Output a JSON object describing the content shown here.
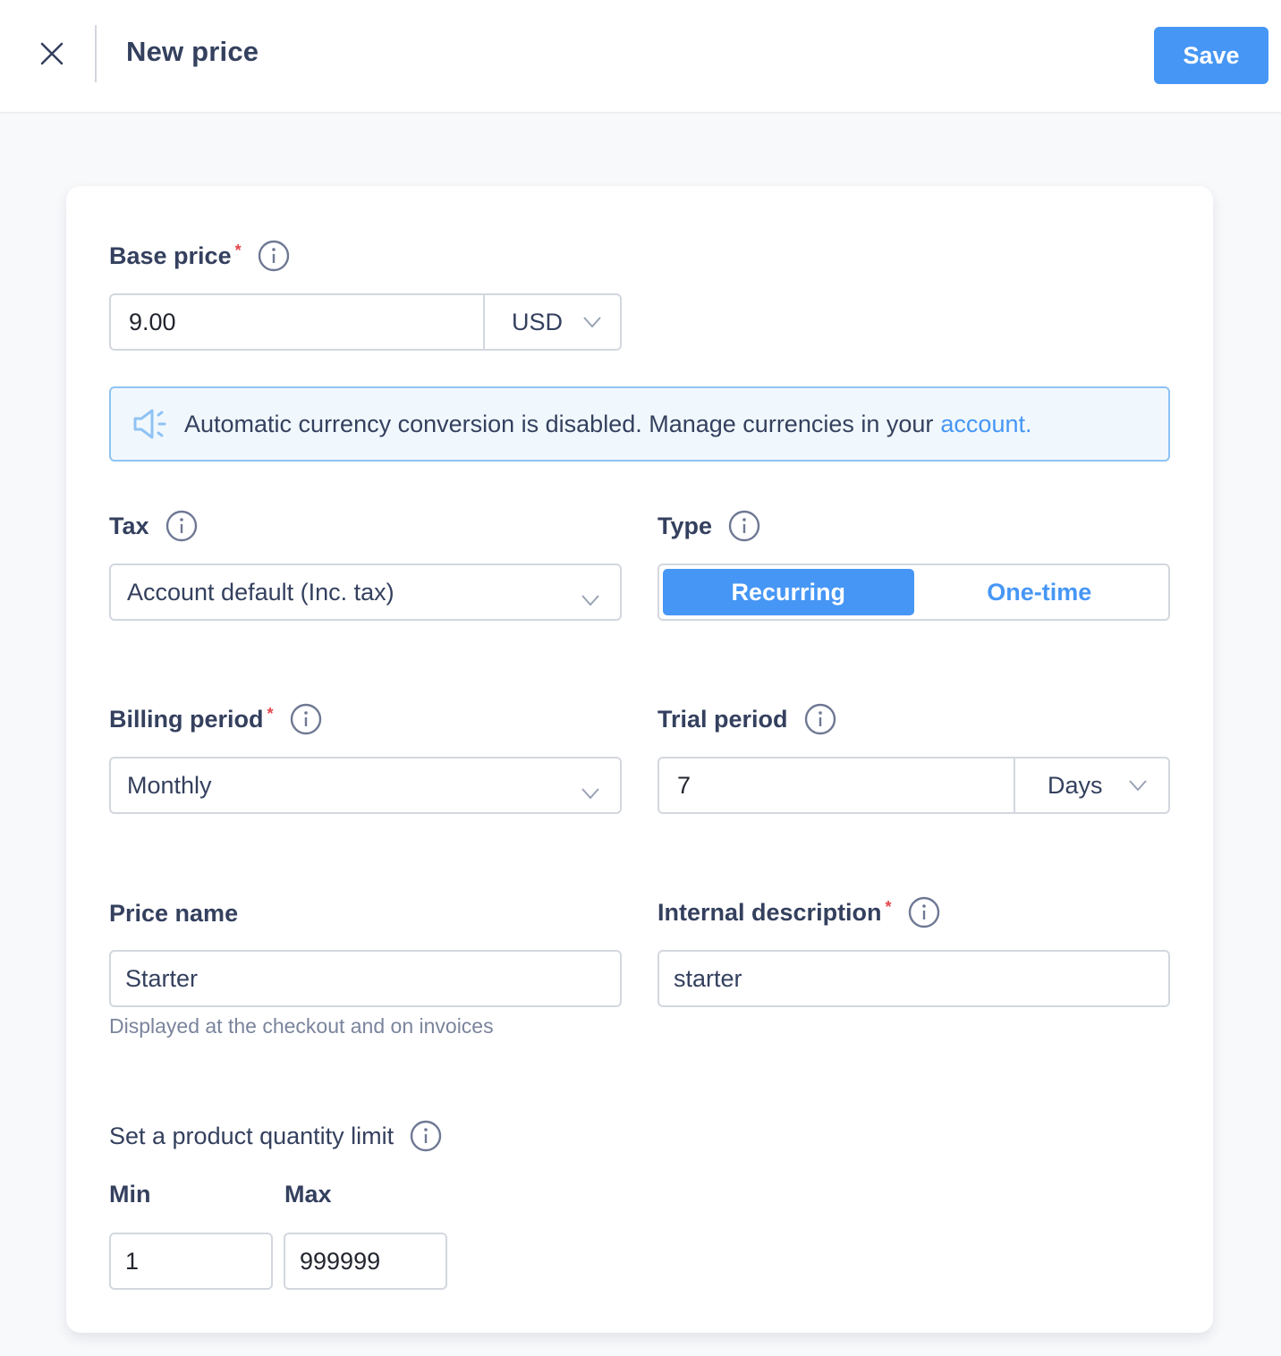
{
  "header": {
    "title": "New price",
    "close_icon": "close-icon",
    "save_label": "Save"
  },
  "form": {
    "base_price": {
      "label": "Base price",
      "required_mark": "*",
      "value": "9.00",
      "currency": "USD"
    },
    "banner": {
      "icon": "megaphone-icon",
      "text": "Automatic currency conversion is disabled. Manage currencies in your",
      "link_text": "account."
    },
    "tax": {
      "label": "Tax",
      "value": "Account default (Inc. tax)"
    },
    "type": {
      "label": "Type",
      "options": [
        "Recurring",
        "One-time"
      ],
      "selected": "Recurring"
    },
    "billing_period": {
      "label": "Billing period",
      "required_mark": "*",
      "value": "Monthly"
    },
    "trial_period": {
      "label": "Trial period",
      "value": "7",
      "unit": "Days"
    },
    "price_name": {
      "label": "Price name",
      "value": "Starter",
      "hint": "Displayed at the checkout and on invoices"
    },
    "internal_description": {
      "label": "Internal description",
      "required_mark": "*",
      "value": "starter"
    },
    "quantity_limit": {
      "title": "Set a product quantity limit",
      "min_label": "Min",
      "min_value": "1",
      "max_label": "Max",
      "max_value": "999999"
    }
  },
  "colors": {
    "accent": "#4696f5",
    "text": "#34405e",
    "required": "#e5484d",
    "banner_bg": "#f1f8fd",
    "banner_border": "#8fc3f5"
  }
}
